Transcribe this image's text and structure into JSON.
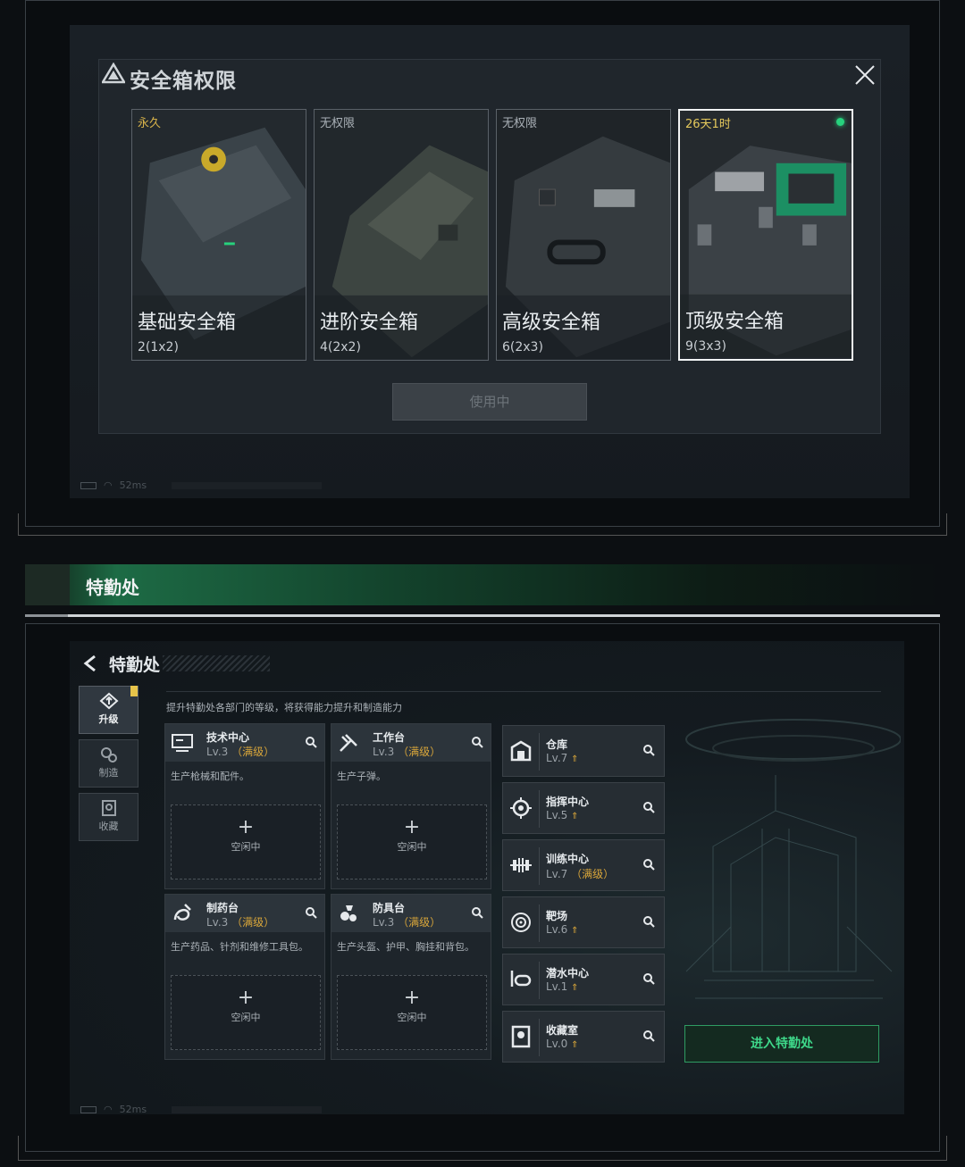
{
  "top": {
    "modal_title": "安全箱权限",
    "cards": [
      {
        "badge": "永久",
        "badge_color": "#d7b24a",
        "name": "基础安全箱",
        "dims": "2(1x2)"
      },
      {
        "badge": "无权限",
        "badge_color": "#aab1b7",
        "name": "进阶安全箱",
        "dims": "4(2x2)"
      },
      {
        "badge": "无权限",
        "badge_color": "#aab1b7",
        "name": "高级安全箱",
        "dims": "6(2x3)"
      },
      {
        "badge": "26天1时",
        "badge_color": "#e5c95c",
        "name": "顶级安全箱",
        "dims": "9(3x3)"
      }
    ],
    "use_button": "使用中",
    "status_latency": "52ms"
  },
  "section": {
    "title": "特勤处"
  },
  "bottom": {
    "title": "特勤处",
    "side_tabs": [
      {
        "label": "升级",
        "icon": "upgrade-icon"
      },
      {
        "label": "制造",
        "icon": "manufacture-icon"
      },
      {
        "label": "收藏",
        "icon": "collection-icon"
      }
    ],
    "description": "提升特勤处各部门的等级，将获得能力提升和制造能力",
    "departments": [
      {
        "name": "技术中心",
        "level": "Lv.3",
        "max": "（满级）",
        "desc": "生产枪械和配件。",
        "slot": "空闲中",
        "icon": "tech-center-icon"
      },
      {
        "name": "工作台",
        "level": "Lv.3",
        "max": "（满级）",
        "desc": "生产子弹。",
        "slot": "空闲中",
        "icon": "workbench-icon"
      },
      {
        "name": "制药台",
        "level": "Lv.3",
        "max": "（满级）",
        "desc": "生产药品、针剂和维修工具包。",
        "slot": "空闲中",
        "icon": "pharmacy-icon"
      },
      {
        "name": "防具台",
        "level": "Lv.3",
        "max": "（满级）",
        "desc": "生产头盔、护甲、胸挂和背包。",
        "slot": "空闲中",
        "icon": "armor-bench-icon"
      }
    ],
    "facilities": [
      {
        "name": "仓库",
        "level": "Lv.7",
        "max": "",
        "upgrade": true,
        "icon": "warehouse-icon"
      },
      {
        "name": "指挥中心",
        "level": "Lv.5",
        "max": "",
        "upgrade": true,
        "icon": "command-center-icon"
      },
      {
        "name": "训练中心",
        "level": "Lv.7",
        "max": "（满级）",
        "upgrade": false,
        "icon": "training-center-icon"
      },
      {
        "name": "靶场",
        "level": "Lv.6",
        "max": "",
        "upgrade": true,
        "icon": "shooting-range-icon"
      },
      {
        "name": "潜水中心",
        "level": "Lv.1",
        "max": "",
        "upgrade": true,
        "icon": "diving-center-icon"
      },
      {
        "name": "收藏室",
        "level": "Lv.0",
        "max": "",
        "upgrade": true,
        "icon": "collection-room-icon"
      }
    ],
    "enter_button": "进入特勤处",
    "status_latency": "52ms",
    "accent_green": "#3ed88a",
    "max_level_color": "#d9a63a"
  }
}
